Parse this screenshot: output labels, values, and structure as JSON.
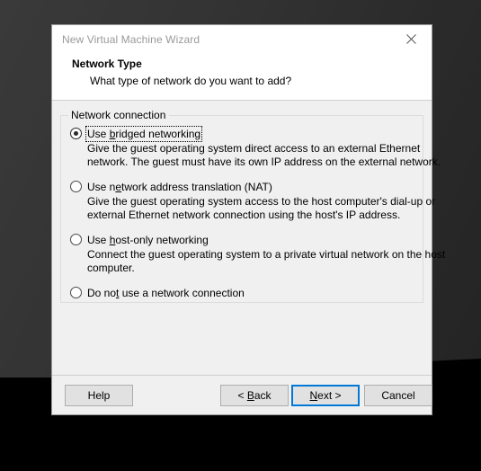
{
  "window": {
    "title": "New Virtual Machine Wizard",
    "close_icon": "close-icon"
  },
  "header": {
    "title": "Network Type",
    "subtitle": "What type of network do you want to add?"
  },
  "group": {
    "legend": "Network connection"
  },
  "options": [
    {
      "id": "bridged",
      "label_pre": "Use ",
      "label_accel": "b",
      "label_post": "ridged networking",
      "selected": true,
      "focused": true,
      "desc_line1": "Give the guest operating system direct access to an external Ethernet",
      "desc_line2": "network. The guest must have its own IP address on the external network."
    },
    {
      "id": "nat",
      "label_pre": "Use n",
      "label_accel": "e",
      "label_post": "twork address translation (NAT)",
      "selected": false,
      "focused": false,
      "desc_line1": "Give the guest operating system access to the host computer's dial-up or",
      "desc_line2": "external Ethernet network connection using the host's IP address."
    },
    {
      "id": "host-only",
      "label_pre": "Use ",
      "label_accel": "h",
      "label_post": "ost-only networking",
      "selected": false,
      "focused": false,
      "desc_line1": "Connect the guest operating system to a private virtual network on the host",
      "desc_line2": "computer."
    },
    {
      "id": "none",
      "label_pre": "Do no",
      "label_accel": "t",
      "label_post": " use a network connection",
      "selected": false,
      "focused": false,
      "desc_line1": "",
      "desc_line2": ""
    }
  ],
  "buttons": {
    "help": "Help",
    "back_pre": "< ",
    "back_accel": "B",
    "back_post": "ack",
    "next_accel": "N",
    "next_post": "ext >",
    "cancel": "Cancel"
  },
  "colors": {
    "accent": "#0078d7",
    "dialog_bg": "#f0f0f0",
    "header_bg": "#ffffff",
    "title_text": "#999999"
  }
}
